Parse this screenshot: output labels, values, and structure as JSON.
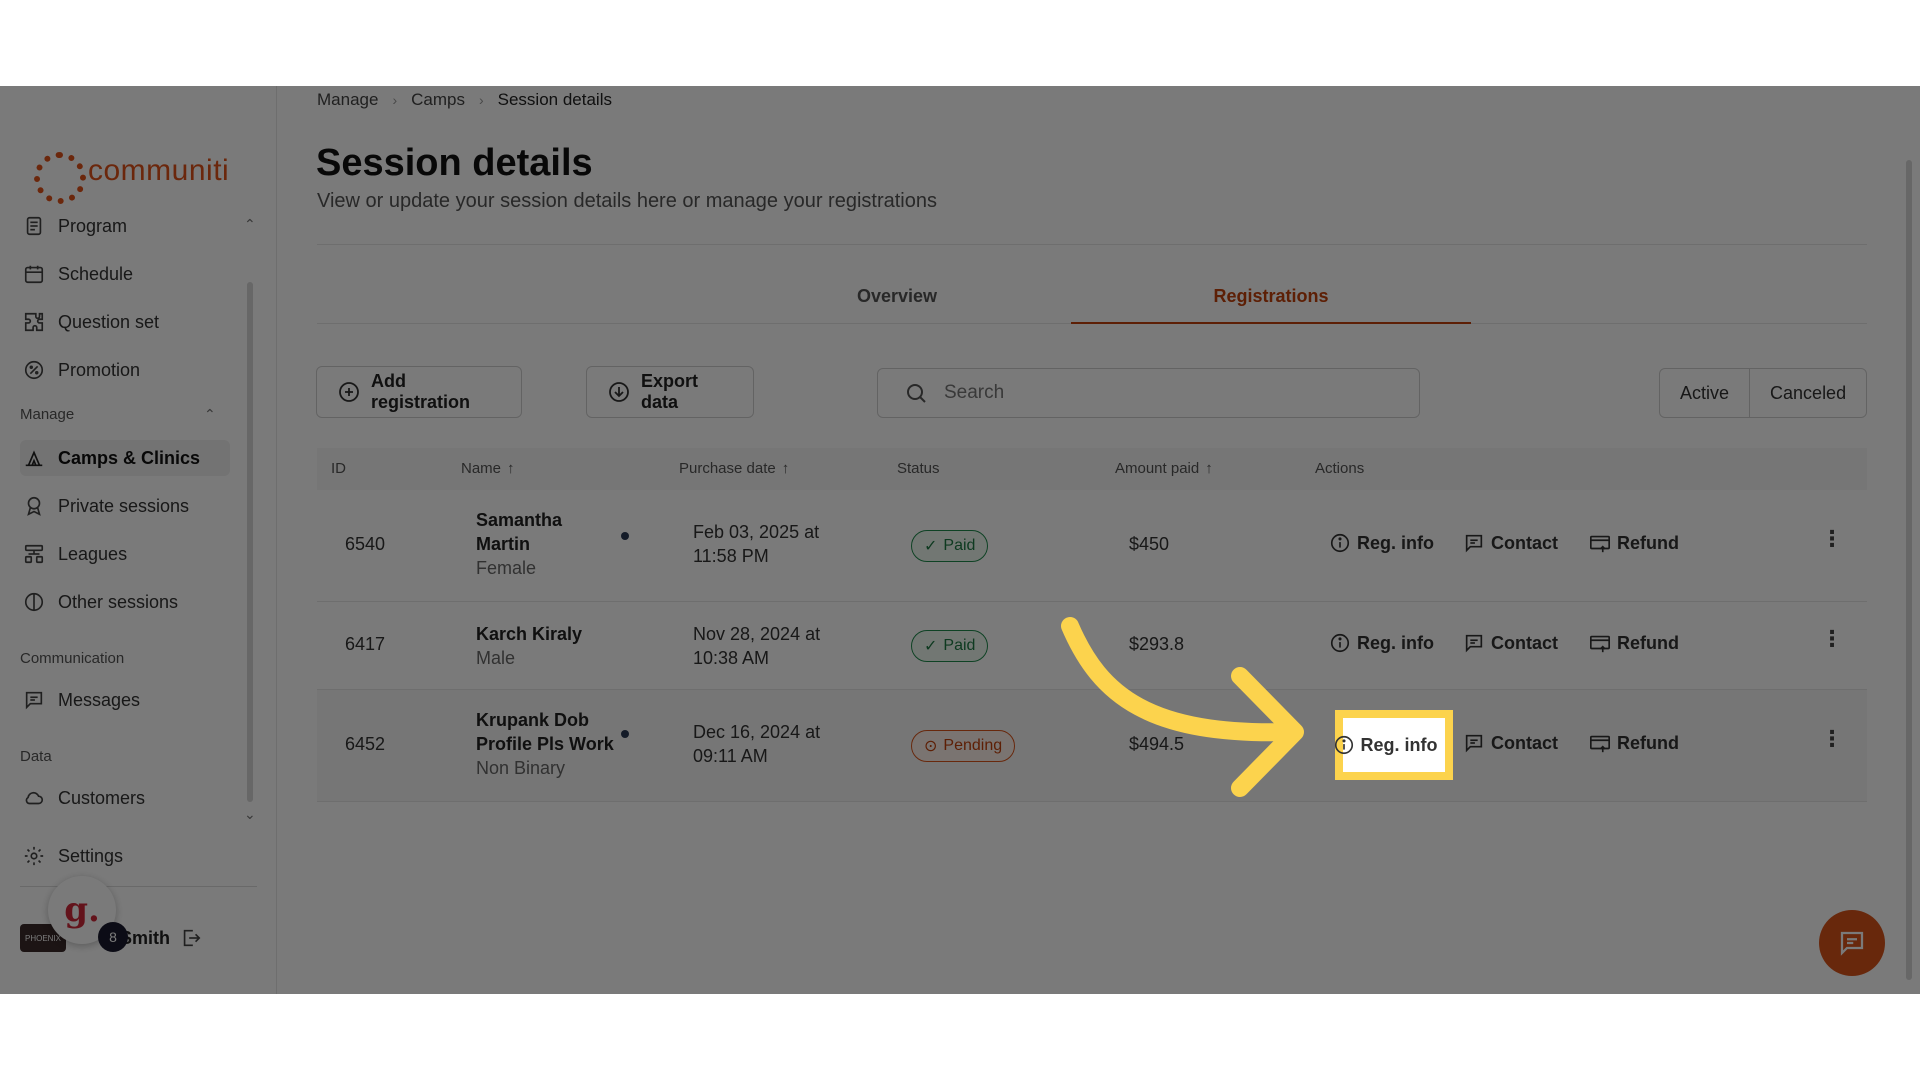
{
  "brand": {
    "name": "communiti",
    "color": "#e0521a"
  },
  "sidebar": {
    "items_top": [
      {
        "label": "Program",
        "icon": "program-icon"
      },
      {
        "label": "Schedule",
        "icon": "calendar-icon"
      },
      {
        "label": "Question set",
        "icon": "puzzle-icon"
      },
      {
        "label": "Promotion",
        "icon": "percent-icon"
      }
    ],
    "manage_label": "Manage",
    "items_manage": [
      {
        "label": "Camps & Clinics",
        "icon": "camp-icon"
      },
      {
        "label": "Private sessions",
        "icon": "ribbon-icon"
      },
      {
        "label": "Leagues",
        "icon": "leagues-icon"
      },
      {
        "label": "Other sessions",
        "icon": "half-circle-icon"
      }
    ],
    "communication_label": "Communication",
    "messages_label": "Messages",
    "data_label": "Data",
    "customers_label": "Customers",
    "settings_label": "Settings",
    "user": {
      "avatar_text": "PHOENIX",
      "name": "Smith",
      "notifications": "8",
      "widget_letter": "g."
    }
  },
  "breadcrumb": [
    "Manage",
    "Camps",
    "Session details"
  ],
  "page": {
    "title": "Session details",
    "subtitle": "View or update your session details here or manage your registrations"
  },
  "tabs": {
    "overview": "Overview",
    "registrations": "Registrations"
  },
  "toolbar": {
    "add_label": "Add registration",
    "export_label": "Export data",
    "search_placeholder": "Search",
    "filter_active": "Active",
    "filter_canceled": "Canceled"
  },
  "table": {
    "headers": {
      "id": "ID",
      "name": "Name",
      "purchase_date": "Purchase date",
      "status": "Status",
      "amount": "Amount paid",
      "actions": "Actions"
    },
    "actions": {
      "reg_info": "Reg. info",
      "contact": "Contact",
      "refund": "Refund"
    },
    "rows": [
      {
        "id": "6540",
        "name_line1": "Samantha",
        "name_line2": "Martin",
        "gender": "Female",
        "date_line1": "Feb 03, 2025 at",
        "date_line2": "11:58 PM",
        "status": "Paid",
        "amount": "$450"
      },
      {
        "id": "6417",
        "name_line1": "Karch Kiraly",
        "gender": "Male",
        "date_line1": "Nov 28, 2024 at",
        "date_line2": "10:38 AM",
        "status": "Paid",
        "amount": "$293.8"
      },
      {
        "id": "6452",
        "name_line1": "Krupank Dob",
        "name_line2": "Profile Pls Work",
        "gender": "Non Binary",
        "date_line1": "Dec 16, 2024 at",
        "date_line2": "09:11 AM",
        "status": "Pending",
        "amount": "$494.5"
      }
    ]
  },
  "highlight": {
    "label": "Reg. info",
    "color": "#fcd34d"
  },
  "colors": {
    "accent": "#c2410c",
    "paid": "#1f8a4c",
    "pending": "#d9541a"
  }
}
